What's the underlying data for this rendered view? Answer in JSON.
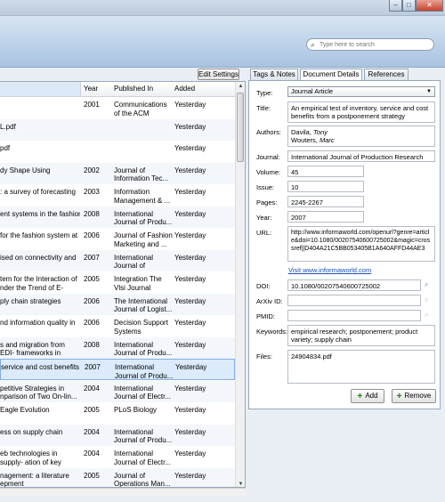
{
  "window": {
    "min": "–",
    "max": "□",
    "close": "✕"
  },
  "search": {
    "placeholder": "Type here to search",
    "icon": "search-icon"
  },
  "toolbar": {
    "edit_settings": "Edit Settings"
  },
  "columns": {
    "year": "Year",
    "published_in": "Published In",
    "added": "Added"
  },
  "rows": [
    {
      "title": "",
      "year": "2001",
      "pub": "Communications of the ACM",
      "added": "Yesterday"
    },
    {
      "title": "L.pdf",
      "year": "",
      "pub": "",
      "added": "Yesterday"
    },
    {
      "title": "pdf",
      "year": "",
      "pub": "",
      "added": "Yesterday"
    },
    {
      "title": "dy Shape Using",
      "year": "2002",
      "pub": "Journal of Information Tec...",
      "added": "Yesterday"
    },
    {
      "title": ": a survey of forecasting",
      "year": "2003",
      "pub": "Information Management & ...",
      "added": "Yesterday"
    },
    {
      "title": "ent systems in the fashion",
      "year": "2008",
      "pub": "International Journal of Produ...",
      "added": "Yesterday"
    },
    {
      "title": "for the fashion system at",
      "year": "2006",
      "pub": "Journal of Fashion Marketing and ...",
      "added": "Yesterday"
    },
    {
      "title": "ised on connectivity and",
      "year": "2007",
      "pub": "International Journal of Opera...",
      "added": "Yesterday"
    },
    {
      "title": "tem for the Interaction of nder the Trend of E-Busi...",
      "year": "2005",
      "pub": "Integration The Vlsi Journal",
      "added": "Yesterday"
    },
    {
      "title": "ply chain strategies",
      "year": "2006",
      "pub": "The International Journal of Logist...",
      "added": "Yesterday"
    },
    {
      "title": "nd information quality in",
      "year": "2006",
      "pub": "Decision Support Systems",
      "added": "Yesterday"
    },
    {
      "title": "s and migration from EDI- frameworks in supply ch...",
      "year": "2008",
      "pub": "International Journal of Produ...",
      "added": "Yesterday"
    },
    {
      "title": "service and cost benefits",
      "year": "2007",
      "pub": "International Journal of Produ...",
      "added": "Yesterday"
    },
    {
      "title": "petitive Strategies in nparison of Two On-lin...",
      "year": "2004",
      "pub": "International Journal of Electr...",
      "added": "Yesterday"
    },
    {
      "title": "Eagle Evolution",
      "year": "2005",
      "pub": "PLoS Biology",
      "added": "Yesterday"
    },
    {
      "title": "ess on supply chain",
      "year": "2004",
      "pub": "International Journal of Produ...",
      "added": "Yesterday"
    },
    {
      "title": "eb technologies in supply- ation of key drivers and p...",
      "year": "2004",
      "pub": "International Journal of Electr...",
      "added": "Yesterday"
    },
    {
      "title": "nagement: a literature epment",
      "year": "2005",
      "pub": "Journal of Operations Man...",
      "added": "Yesterday"
    }
  ],
  "tabs": [
    {
      "label": "Tags & Notes"
    },
    {
      "label": "Document Details"
    },
    {
      "label": "References"
    }
  ],
  "details": {
    "type_label": "Type:",
    "type_value": "Journal Article",
    "title_label": "Title:",
    "title_value": "An empirical test of inventory, service and cost benefits from a postponement strategy",
    "authors_label": "Authors:",
    "author1_last": "Davila, ",
    "author1_first": "Tony",
    "author2_last": "Wouters, ",
    "author2_first": "Marc",
    "journal_label": "Journal:",
    "journal_value": "International Journal of Production Research",
    "volume_label": "Volume:",
    "volume_value": "45",
    "issue_label": "Issue:",
    "issue_value": "10",
    "pages_label": "Pages:",
    "pages_value": "2245-2267",
    "year_label": "Year:",
    "year_value": "2007",
    "url_label": "URL:",
    "url_value": "http://www.informaworld.com/openurl?genre=article&doi=10.1080/00207540600725002&magic=crossref||D404A21C5BB053405B1A640AFFD44AE3",
    "visit_link": "Visit www.informaworld.com",
    "doi_label": "DOI:",
    "doi_value": "10.1080/00207540600725002",
    "arxiv_label": "ArXiv ID:",
    "arxiv_value": "",
    "pmid_label": "PMID:",
    "pmid_value": "",
    "keywords_label": "Keywords:",
    "keywords_value": "empirical research; postponement; product variety; supply chain",
    "files_label": "Files:",
    "files_value": "24904834.pdf"
  },
  "buttons": {
    "add": "Add",
    "remove": "Remove"
  }
}
